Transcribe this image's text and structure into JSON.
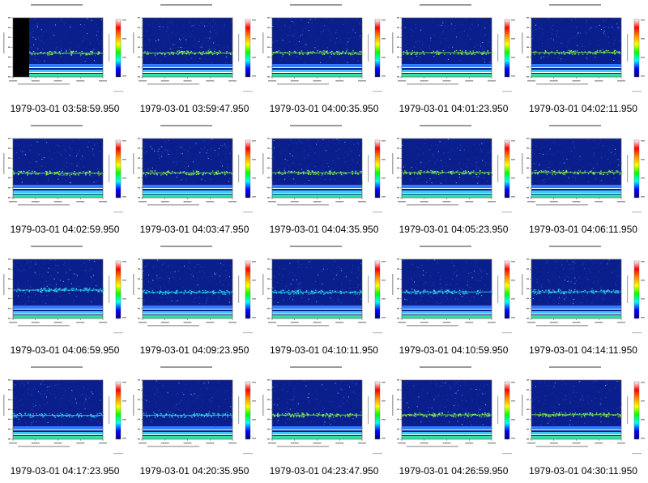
{
  "panels": [
    {
      "timestamp": "1979-03-01 03:58:59.950"
    },
    {
      "timestamp": "1979-03-01 03:59:47.950"
    },
    {
      "timestamp": "1979-03-01 04:00:35.950"
    },
    {
      "timestamp": "1979-03-01 04:01:23.950"
    },
    {
      "timestamp": "1979-03-01 04:02:11.950"
    },
    {
      "timestamp": "1979-03-01 04:02:59.950"
    },
    {
      "timestamp": "1979-03-01 04:03:47.950"
    },
    {
      "timestamp": "1979-03-01 04:04:35.950"
    },
    {
      "timestamp": "1979-03-01 04:05:23.950"
    },
    {
      "timestamp": "1979-03-01 04:06:11.950"
    },
    {
      "timestamp": "1979-03-01 04:06:59.950"
    },
    {
      "timestamp": "1979-03-01 04:09:23.950"
    },
    {
      "timestamp": "1979-03-01 04:10:11.950"
    },
    {
      "timestamp": "1979-03-01 04:10:59.950"
    },
    {
      "timestamp": "1979-03-01 04:14:11.950"
    },
    {
      "timestamp": "1979-03-01 04:17:23.950"
    },
    {
      "timestamp": "1979-03-01 04:20:35.950"
    },
    {
      "timestamp": "1979-03-01 04:23:47.950"
    },
    {
      "timestamp": "1979-03-01 04:26:59.950"
    },
    {
      "timestamp": "1979-03-01 04:30:11.950"
    }
  ],
  "colors": {
    "background": "#ffffff",
    "spectrogram_base": "#0a1e8c",
    "band_green": "#7cf04a",
    "band_cyan": "#2fd8e8",
    "white_line": "#ffffff",
    "colorbar": [
      "#ffffff",
      "#ff0000",
      "#ff8c00",
      "#ffff00",
      "#00ff00",
      "#00ffff",
      "#0000ff",
      "#000080"
    ]
  }
}
